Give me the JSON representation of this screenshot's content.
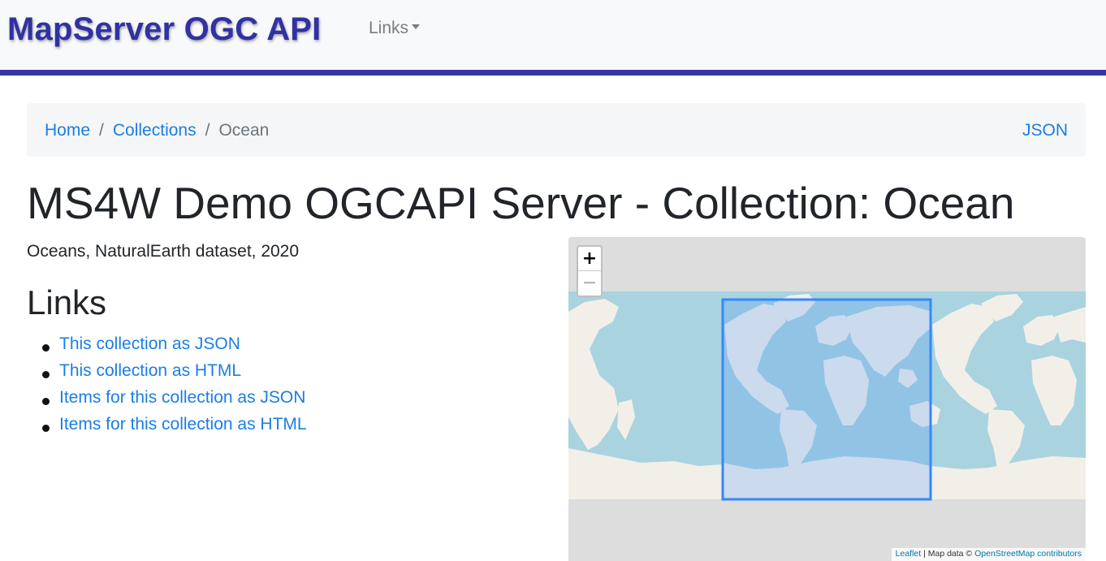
{
  "header": {
    "brand": "MapServer OGC API",
    "menu_label": "Links"
  },
  "breadcrumb": {
    "items": [
      {
        "label": "Home"
      },
      {
        "label": "Collections"
      }
    ],
    "separator": "/",
    "current": "Ocean",
    "json_label": "JSON"
  },
  "main": {
    "title": "MS4W Demo OGCAPI Server - Collection: Ocean",
    "description": "Oceans, NaturalEarth dataset, 2020",
    "links_heading": "Links",
    "links": [
      {
        "label": "This collection as JSON"
      },
      {
        "label": "This collection as HTML"
      },
      {
        "label": "Items for this collection as JSON"
      },
      {
        "label": "Items for this collection as HTML"
      }
    ]
  },
  "map": {
    "zoom_in": "+",
    "zoom_out": "−",
    "attribution": {
      "leaflet": "Leaflet",
      "separator": " | Map data © ",
      "osm": "OpenStreetMap contributors"
    },
    "colors": {
      "ocean": "#a9d3df",
      "land": "#f2efe9",
      "extent_stroke": "#3388ff",
      "background": "#dddddd"
    }
  },
  "colors": {
    "brand": "#3131a4",
    "link": "#1a7ee6",
    "rule": "#3535a3"
  }
}
